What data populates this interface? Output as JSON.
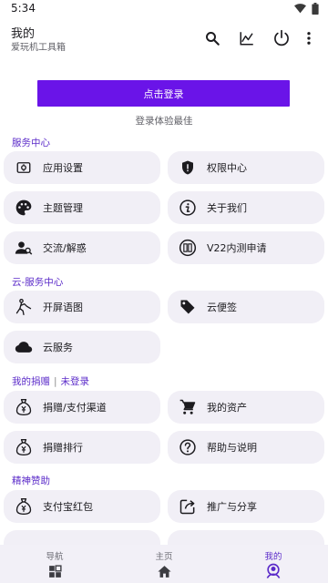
{
  "status_bar": {
    "time": "5:34"
  },
  "app_bar": {
    "title": "我的",
    "subtitle": "爱玩机工具箱",
    "actions": [
      "search-icon",
      "chart-icon",
      "power-icon",
      "more-vert-icon"
    ]
  },
  "login": {
    "button_label": "点击登录",
    "hint": "登录体验最佳"
  },
  "sections": [
    {
      "title": "服务中心",
      "items": [
        {
          "label": "应用设置",
          "icon": "settings-icon"
        },
        {
          "label": "权限中心",
          "icon": "shield-icon"
        },
        {
          "label": "主题管理",
          "icon": "palette-icon"
        },
        {
          "label": "关于我们",
          "icon": "info-icon"
        },
        {
          "label": "交流/解惑",
          "icon": "people-icon"
        },
        {
          "label": "V22内测申请",
          "icon": "test-badge-icon"
        }
      ]
    },
    {
      "title": "云-服务中心",
      "items": [
        {
          "label": "开屏语图",
          "icon": "splash-figure-icon"
        },
        {
          "label": "云便签",
          "icon": "tag-icon"
        },
        {
          "label": "云服务",
          "icon": "cloud-icon"
        }
      ]
    },
    {
      "title": "我的捐赠",
      "title_status": "未登录",
      "items": [
        {
          "label": "捐赠/支付渠道",
          "icon": "money-bag-icon"
        },
        {
          "label": "我的资产",
          "icon": "cart-icon"
        },
        {
          "label": "捐赠排行",
          "icon": "money-bag-icon"
        },
        {
          "label": "帮助与说明",
          "icon": "help-icon"
        }
      ]
    },
    {
      "title": "精神赞助",
      "items": [
        {
          "label": "支付宝红包",
          "icon": "money-bag-icon"
        },
        {
          "label": "推广与分享",
          "icon": "share-icon"
        }
      ]
    }
  ],
  "bottom_nav": {
    "items": [
      {
        "label": "导航",
        "icon": "grid-icon"
      },
      {
        "label": "主页",
        "icon": "home-icon"
      },
      {
        "label": "我的",
        "icon": "profile-icon",
        "active": true
      }
    ]
  },
  "colors": {
    "accent": "#6a14e8",
    "section_title": "#5b2bc9",
    "card_bg": "#f1eff6"
  }
}
